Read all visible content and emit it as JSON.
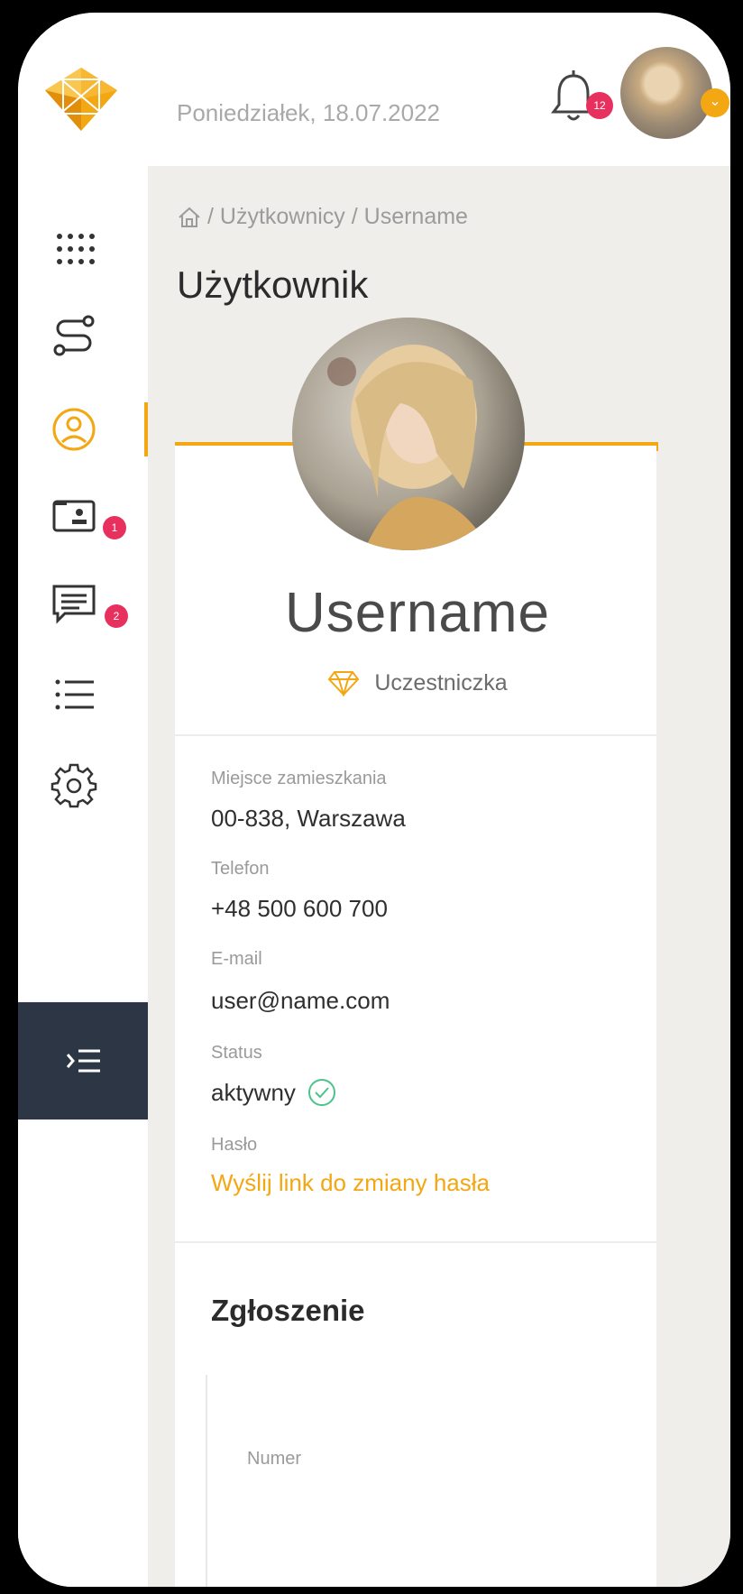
{
  "header": {
    "date": "Poniedziałek, 18.07.2022",
    "notifications_count": "12"
  },
  "sidebar": {
    "items": [
      {
        "name": "apps-grid-icon"
      },
      {
        "name": "route-icon"
      },
      {
        "name": "user-icon"
      },
      {
        "name": "id-card-icon",
        "badge": "1"
      },
      {
        "name": "message-icon",
        "badge": "2"
      },
      {
        "name": "list-icon"
      },
      {
        "name": "gear-icon"
      }
    ]
  },
  "breadcrumb": {
    "segments": [
      "/ Użytkownicy / Username"
    ]
  },
  "page": {
    "title": "Użytkownik"
  },
  "profile": {
    "username": "Username",
    "role": "Uczestniczka"
  },
  "details": {
    "residence_label": "Miejsce zamieszkania",
    "residence_value": "00-838, Warszawa",
    "phone_label": "Telefon",
    "phone_value": "+48 500 600 700",
    "email_label": "E-mail",
    "email_value": "user@name.com",
    "status_label": "Status",
    "status_value": "aktywny",
    "password_label": "Hasło",
    "password_link": "Wyślij link do zmiany hasła"
  },
  "submission": {
    "title": "Zgłoszenie",
    "number_label": "Numer"
  },
  "colors": {
    "accent": "#f3a712",
    "badge": "#e8305f",
    "sidebar_dark": "#2c3644"
  }
}
